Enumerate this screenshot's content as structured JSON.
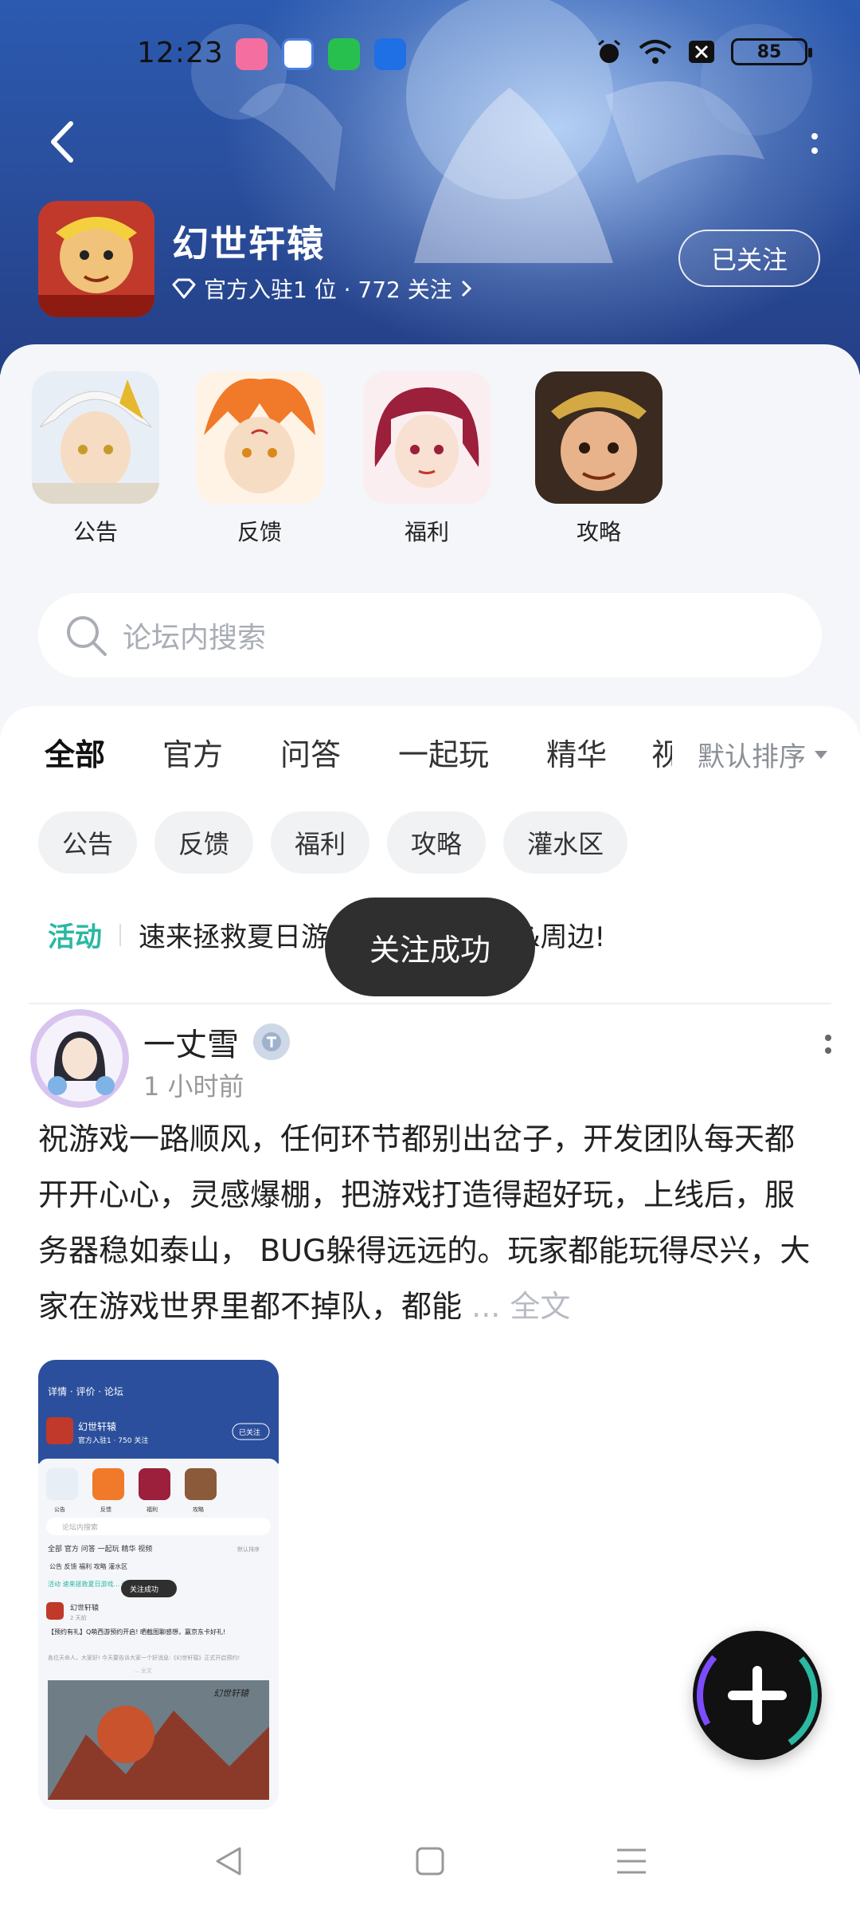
{
  "status_bar": {
    "time": "12:23",
    "battery": "85",
    "app_icons": [
      "bilibili-icon",
      "gamepad-app-icon",
      "shield-app-icon",
      "browser-app-icon"
    ],
    "system_icons": [
      "alarm-icon",
      "wifi-icon",
      "close-box-icon",
      "battery-icon"
    ]
  },
  "header": {
    "game_name": "幻世轩辕",
    "meta": "官方入驻1 位 · 772 关注",
    "follow_label": "已关注"
  },
  "quick_links": [
    {
      "label": "公告"
    },
    {
      "label": "反馈"
    },
    {
      "label": "福利"
    },
    {
      "label": "攻略"
    }
  ],
  "search": {
    "placeholder": "论坛内搜索"
  },
  "tabs": [
    "全部",
    "官方",
    "问答",
    "一起玩",
    "精华",
    "视"
  ],
  "tab_active": "全部",
  "sort": {
    "label": "默认排序"
  },
  "chips": [
    "公告",
    "反馈",
    "福利",
    "攻略",
    "灌水区"
  ],
  "activity": {
    "tag": "活动",
    "text": "速来拯救夏日游",
    "text_tail": "&周边!"
  },
  "toast": "关注成功",
  "post": {
    "author": "一丈雪",
    "time": "1 小时前",
    "body": "祝游戏一路顺风，任何环节都别出岔子，开发团队每天都开开心心，灵感爆棚，把游戏打造得超好玩，上线后，服务器稳如泰山， BUG躲得远远的。玩家都能玩得尽兴，大家在游戏世界里都不掉队，都能",
    "more_label": "... 全文"
  },
  "thumbnail": {
    "tabs": "详情 · 评价 · 论坛",
    "game_name": "幻世轩辕",
    "followed": "已关注",
    "meta": "官方入驻1 · 750 关注",
    "quick_labels": [
      "公告",
      "反馈",
      "福利",
      "攻略"
    ],
    "search": "论坛内搜索",
    "tabs_row": "全部  官方  问答  一起玩  精华  视频",
    "sort": "默认排序",
    "chips": "公告  反馈  福利  攻略  灌水区",
    "activity": "活动  速来拯救夏日游戏... 边!",
    "toast": "关注成功",
    "post_author": "幻世轩辕",
    "post_time": "2 天前",
    "post_title": "【预约有礼】Q萌西游预约开启! 晒截图聊感想，赢京东卡好礼!",
    "post_excerpt": "各位天命人，大家好! 今天要告诉大家一个好消息:《幻世轩辕》正式开启预约!",
    "post_more": "... 全文",
    "banner_text": "幻世轩辕"
  },
  "colors": {
    "banner": "#2a4f9e",
    "accent": "#2bb8a2",
    "toast": "#2f2f2f"
  }
}
